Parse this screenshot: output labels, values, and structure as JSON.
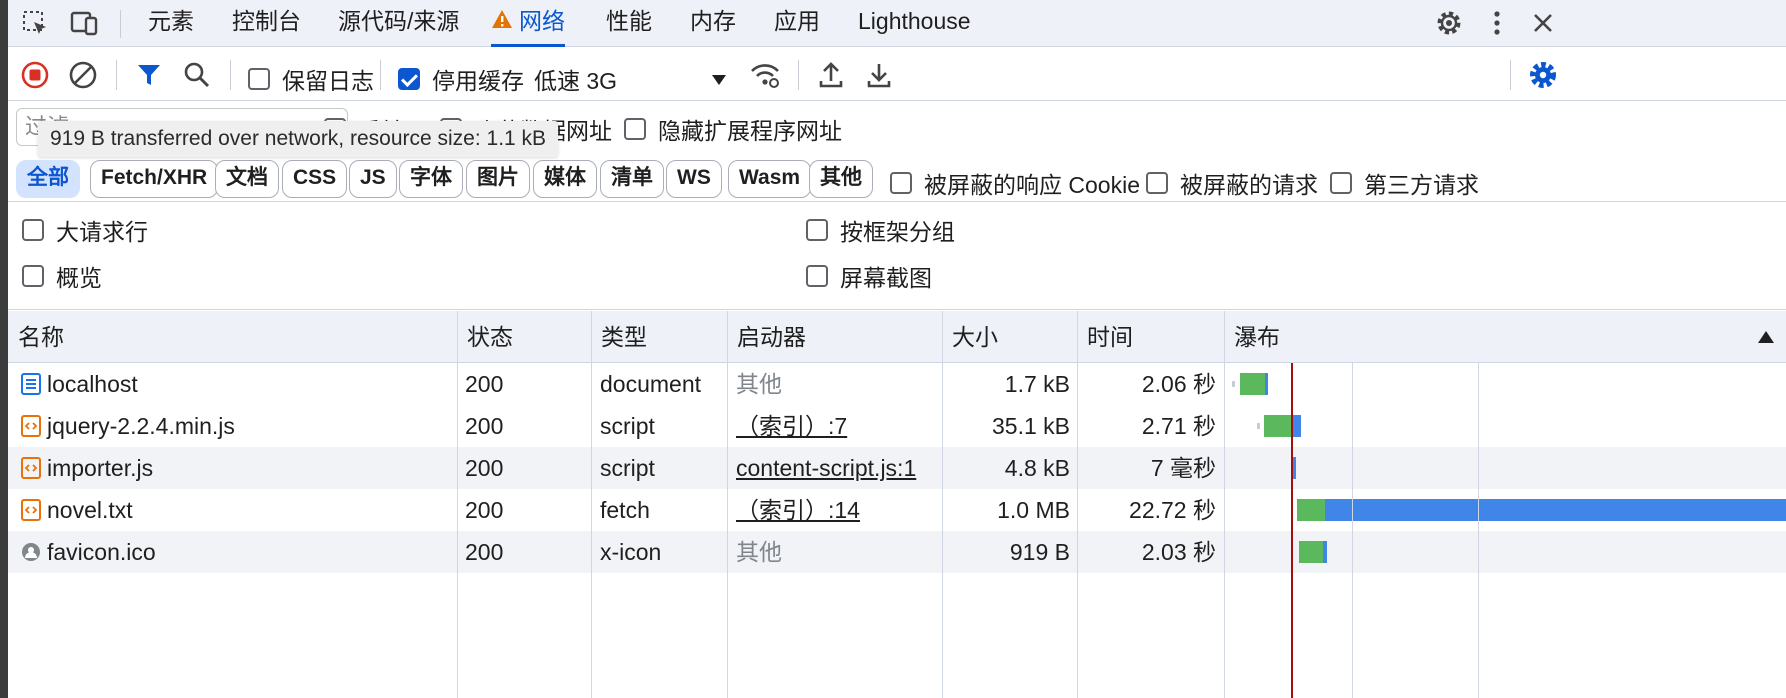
{
  "tabs": [
    {
      "label": "元素"
    },
    {
      "label": "控制台"
    },
    {
      "label": "源代码/来源"
    },
    {
      "label": "网络"
    },
    {
      "label": "性能"
    },
    {
      "label": "内存"
    },
    {
      "label": "应用"
    },
    {
      "label": "Lighthouse"
    }
  ],
  "toolbar": {
    "preserve_log": "保留日志",
    "disable_cache": "停用缓存",
    "throttling": "低速 3G"
  },
  "filter": {
    "placeholder": "过滤",
    "invert": "反转",
    "hide_data_urls": "隐藏数据网址",
    "hide_extension_urls": "隐藏扩展程序网址"
  },
  "tooltip": "919 B transferred over network, resource size: 1.1 kB",
  "chips": [
    "全部",
    "Fetch/XHR",
    "文档",
    "CSS",
    "JS",
    "字体",
    "图片",
    "媒体",
    "清单",
    "WS",
    "Wasm",
    "其他"
  ],
  "chip_filters": {
    "blocked_cookies": "被屏蔽的响应 Cookie",
    "blocked_requests": "被屏蔽的请求",
    "third_party": "第三方请求"
  },
  "options": {
    "big_rows": "大请求行",
    "group_by_frame": "按框架分组",
    "overview": "概览",
    "screenshots": "屏幕截图"
  },
  "columns": {
    "name": "名称",
    "status": "状态",
    "type": "类型",
    "initiator": "启动器",
    "size": "大小",
    "time": "时间",
    "waterfall": "瀑布"
  },
  "rows": [
    {
      "name": "localhost",
      "status": "200",
      "type": "document",
      "initiator": "其他",
      "size": "1.7 kB",
      "time": "2.06 秒"
    },
    {
      "name": "jquery-2.2.4.min.js",
      "status": "200",
      "type": "script",
      "initiator": "（索引）:7",
      "size": "35.1 kB",
      "time": "2.71 秒"
    },
    {
      "name": "importer.js",
      "status": "200",
      "type": "script",
      "initiator": "content-script.js:1",
      "size": "4.8 kB",
      "time": "7 毫秒"
    },
    {
      "name": "novel.txt",
      "status": "200",
      "type": "fetch",
      "initiator": "（索引）:14",
      "size": "1.0 MB",
      "time": "22.72 秒"
    },
    {
      "name": "favicon.ico",
      "status": "200",
      "type": "x-icon",
      "initiator": "其他",
      "size": "919 B",
      "time": "2.03 秒"
    }
  ],
  "colors": {
    "accent": "#0b57d0",
    "record": "#d93025",
    "waiting": "#5cb85c",
    "download": "#3f86e8",
    "warn": "#e37400"
  }
}
